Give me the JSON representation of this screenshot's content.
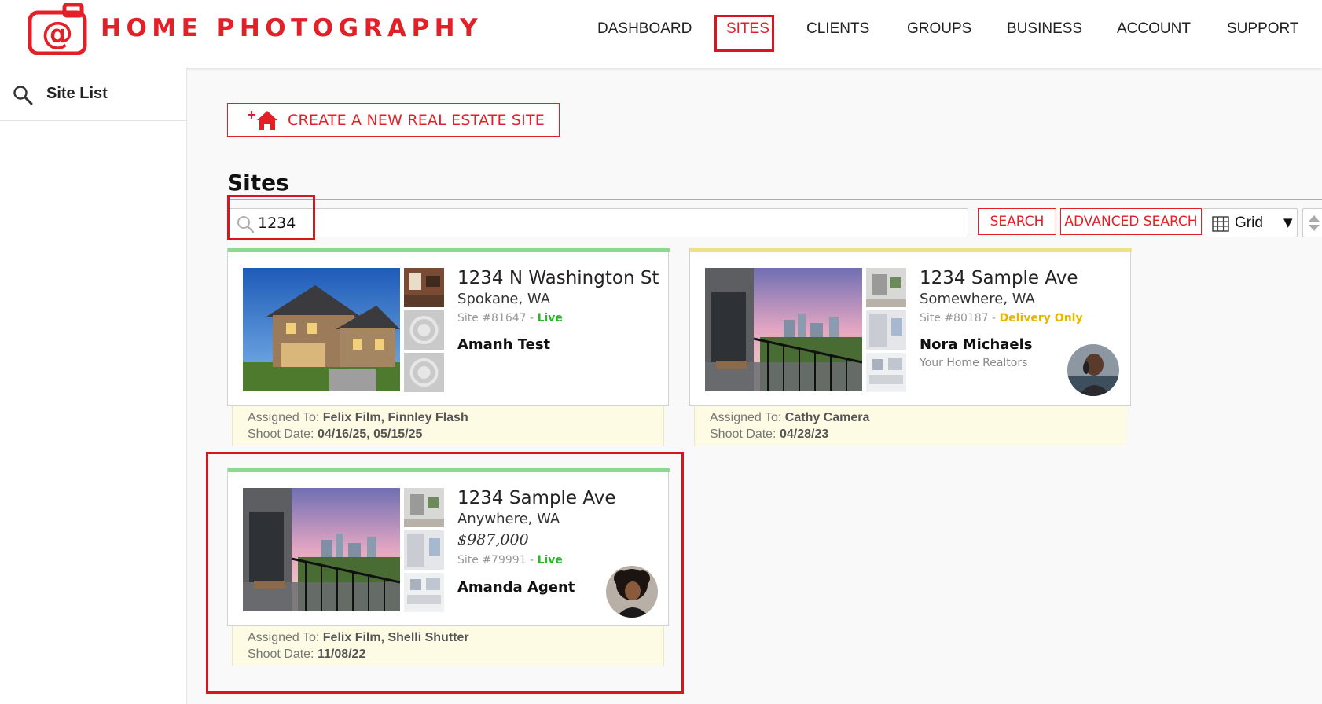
{
  "header": {
    "brand": "HOME PHOTOGRAPHY",
    "nav": [
      {
        "label": "DASHBOARD"
      },
      {
        "label": "SITES"
      },
      {
        "label": "CLIENTS"
      },
      {
        "label": "GROUPS"
      },
      {
        "label": "BUSINESS"
      },
      {
        "label": "ACCOUNT"
      },
      {
        "label": "SUPPORT"
      }
    ],
    "active_nav": "SITES"
  },
  "sidebar": {
    "title": "Site List"
  },
  "main": {
    "create_button": "CREATE A NEW REAL ESTATE SITE",
    "section_title": "Sites",
    "search": {
      "value": "1234"
    },
    "search_button": "SEARCH",
    "advanced_search_button": "ADVANCED SEARCH",
    "view_select": {
      "selected": "Grid"
    }
  },
  "sites": [
    {
      "address": "1234 N Washington St",
      "city": "Spokane, WA",
      "price": "",
      "site_number": "Site #81647 -",
      "status": "Live",
      "status_color": "#2db52d",
      "agent": "Amanh Test",
      "company": "",
      "assigned_label": "Assigned To:",
      "assigned_to": "Felix Film, Finnley Flash",
      "shoot_label": "Shoot Date:",
      "shoot_date": "04/16/25, 05/15/25",
      "topbar_color": "#8ed98e"
    },
    {
      "address": "1234 Sample Ave",
      "city": "Somewhere, WA",
      "price": "",
      "site_number": "Site #80187 -",
      "status": "Delivery Only",
      "status_color": "#e5b800",
      "agent": "Nora Michaels",
      "company": "Your Home Realtors",
      "assigned_label": "Assigned To:",
      "assigned_to": "Cathy Camera",
      "shoot_label": "Shoot Date:",
      "shoot_date": "04/28/23",
      "topbar_color": "#f0e08a"
    },
    {
      "address": "1234 Sample Ave",
      "city": "Anywhere, WA",
      "price": "$987,000",
      "site_number": "Site #79991 -",
      "status": "Live",
      "status_color": "#2db52d",
      "agent": "Amanda Agent",
      "company": "",
      "assigned_label": "Assigned To:",
      "assigned_to": "Felix Film, Shelli Shutter",
      "shoot_label": "Shoot Date:",
      "shoot_date": "11/08/22",
      "topbar_color": "#8ed98e"
    }
  ],
  "colors": {
    "brand_red": "#e32027",
    "live_green": "#2db52d",
    "delivery_yellow": "#e5b800"
  }
}
